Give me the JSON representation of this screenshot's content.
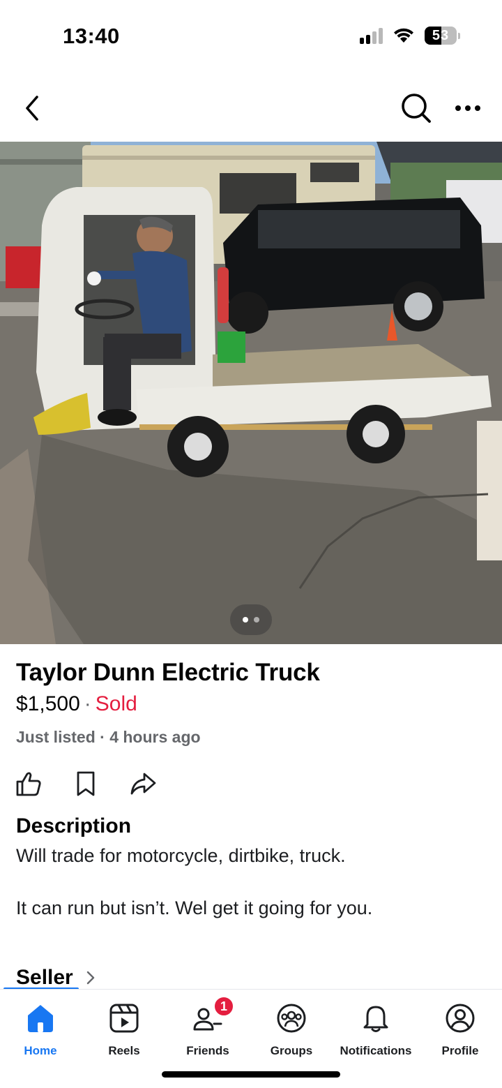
{
  "status_bar": {
    "time": "13:40",
    "battery": "53",
    "battery_level": 0.53,
    "icons": [
      "cellular-signal-icon",
      "wifi-icon",
      "battery-icon"
    ]
  },
  "nav": {
    "back_icon": "chevron-left-icon",
    "search_icon": "search-icon",
    "more_icon": "more-horizontal-icon"
  },
  "photo": {
    "image_index": 1,
    "image_count": 2
  },
  "listing": {
    "title": "Taylor Dunn Electric Truck",
    "price": "$1,500",
    "separator": "·",
    "status": "Sold",
    "meta": "Just listed · 4 hours ago",
    "actions": [
      "like-icon",
      "save-icon",
      "share-icon"
    ]
  },
  "description": {
    "heading": "Description",
    "line1": "Will trade for motorcycle, dirtbike, truck.",
    "line2": "It can run but isn’t. Wel get it going for you."
  },
  "seller": {
    "label": "Seller",
    "icon": "chevron-right-icon"
  },
  "tabs": [
    {
      "label": "Home",
      "icon": "home-icon",
      "active": true
    },
    {
      "label": "Reels",
      "icon": "reels-icon",
      "active": false
    },
    {
      "label": "Friends",
      "icon": "friends-icon",
      "active": false,
      "badge": "1"
    },
    {
      "label": "Groups",
      "icon": "groups-icon",
      "active": false
    },
    {
      "label": "Notifications",
      "icon": "bell-icon",
      "active": false
    },
    {
      "label": "Profile",
      "icon": "profile-icon",
      "active": false
    }
  ],
  "colors": {
    "accent": "#1877f2",
    "sold": "#e41e3f",
    "secondary_text": "#65676b"
  }
}
